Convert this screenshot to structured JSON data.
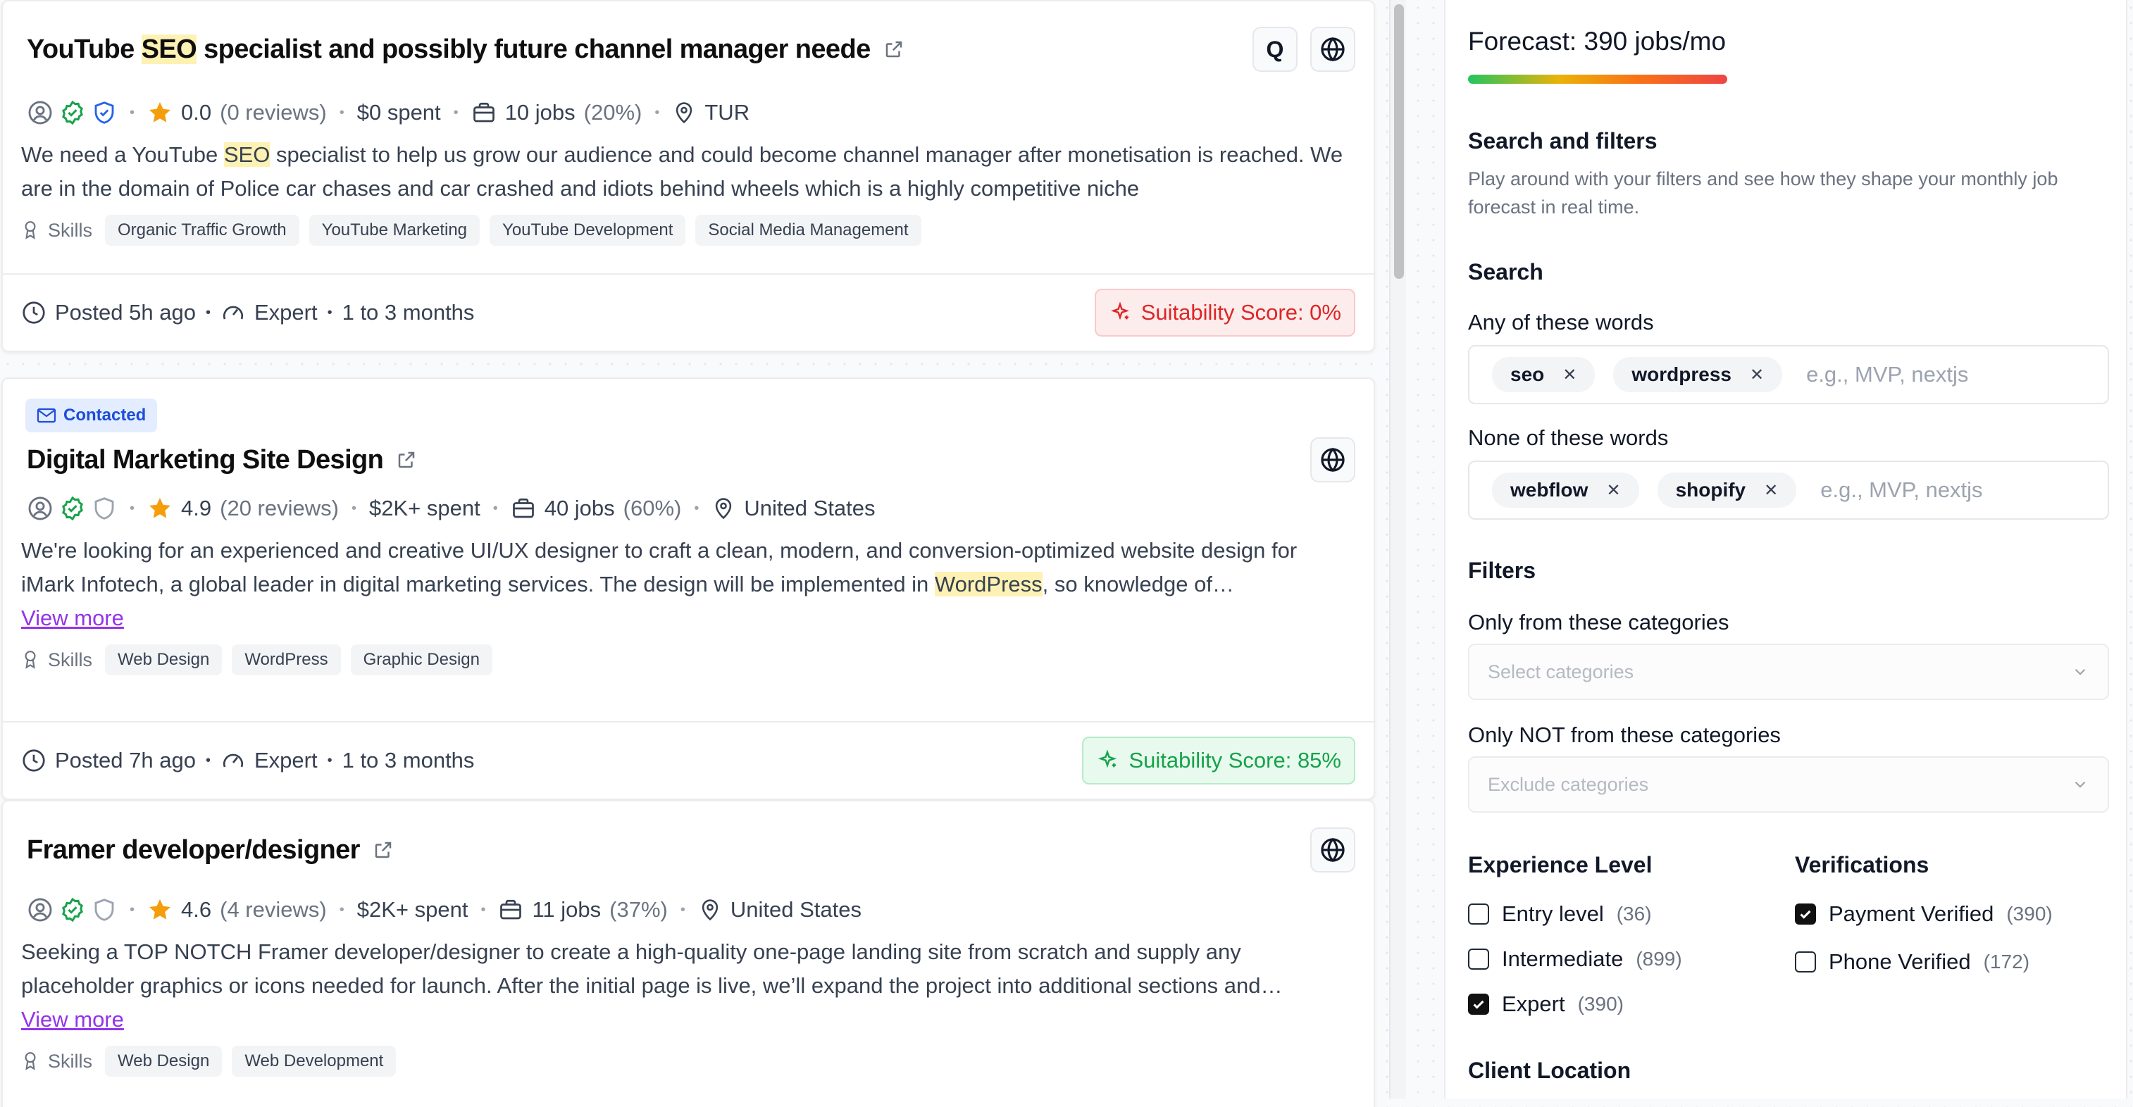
{
  "jobs": [
    {
      "contacted": false,
      "title_parts": [
        "YouTube ",
        "SEO",
        " specialist and possibly future channel manager neede"
      ],
      "show_q_button": true,
      "q_label": "Q",
      "rating": "0.0",
      "reviews": "(0 reviews)",
      "spent": "$0 spent",
      "jobs_count": "10 jobs",
      "jobs_pct": "(20%)",
      "location": "TUR",
      "payment_verified": true,
      "phone_verified": true,
      "desc_parts": [
        "We need a YouTube ",
        "SEO",
        " specialist to help us grow our audience and could become channel manager after monetisation is reached. We are in the domain of Police car chases and car crashed and idiots behind wheels which is a highly competitive niche"
      ],
      "view_more": "",
      "skills": [
        "Organic Traffic Growth",
        "YouTube Marketing",
        "YouTube Development",
        "Social Media Management"
      ],
      "posted": "Posted 5h ago",
      "level": "Expert",
      "duration": "1 to 3 months",
      "score": "Suitability Score: 0%",
      "score_kind": "bad"
    },
    {
      "contacted": true,
      "title_parts": [
        "Digital Marketing Site Design",
        "",
        ""
      ],
      "show_q_button": false,
      "q_label": "",
      "rating": "4.9",
      "reviews": "(20 reviews)",
      "spent": "$2K+ spent",
      "jobs_count": "40 jobs",
      "jobs_pct": "(60%)",
      "location": "United States",
      "payment_verified": true,
      "phone_verified": false,
      "desc_parts": [
        "We're looking for an experienced and creative UI/UX designer to craft a clean, modern, and conversion-optimized website design for iMark Infotech, a global leader in digital marketing services. The design will be implemented in ",
        "WordPress",
        ", so knowledge of…"
      ],
      "view_more": "View more",
      "skills": [
        "Web Design",
        "WordPress",
        "Graphic Design"
      ],
      "posted": "Posted 7h ago",
      "level": "Expert",
      "duration": "1 to 3 months",
      "score": "Suitability Score: 85%",
      "score_kind": "good"
    },
    {
      "contacted": false,
      "title_parts": [
        "Framer developer/designer",
        "",
        ""
      ],
      "show_q_button": false,
      "q_label": "",
      "rating": "4.6",
      "reviews": "(4 reviews)",
      "spent": "$2K+ spent",
      "jobs_count": "11 jobs",
      "jobs_pct": "(37%)",
      "location": "United States",
      "payment_verified": true,
      "phone_verified": false,
      "desc_parts": [
        "Seeking a TOP NOTCH Framer developer/designer to create a high-quality one-page landing site from scratch and supply any placeholder graphics or icons needed for launch. After the initial page is live, we’ll expand the project into additional sections and…",
        "",
        ""
      ],
      "view_more": "View more",
      "skills": [
        "Web Design",
        "Web Development"
      ],
      "posted": "",
      "level": "",
      "duration": "",
      "score": "",
      "score_kind": ""
    }
  ],
  "common": {
    "contacted_label": "Contacted",
    "skills_label": "Skills"
  },
  "panel": {
    "forecast": "Forecast: 390 jobs/mo",
    "search_filters_title": "Search and filters",
    "search_filters_desc": "Play around with your filters and see how they shape your monthly job forecast in real time.",
    "search_title": "Search",
    "any_words_label": "Any of these words",
    "any_words": [
      "seo",
      "wordpress"
    ],
    "none_words_label": "None of these words",
    "none_words": [
      "webflow",
      "shopify"
    ],
    "tag_placeholder": "e.g., MVP, nextjs",
    "filters_title": "Filters",
    "only_categories_label": "Only from these categories",
    "only_categories_placeholder": "Select categories",
    "not_categories_label": "Only NOT from these categories",
    "not_categories_placeholder": "Exclude categories",
    "experience_title": "Experience Level",
    "experience": [
      {
        "label": "Entry level",
        "count": "(36)",
        "checked": false
      },
      {
        "label": "Intermediate",
        "count": "(899)",
        "checked": false
      },
      {
        "label": "Expert",
        "count": "(390)",
        "checked": true
      }
    ],
    "verifications_title": "Verifications",
    "verifications": [
      {
        "label": "Payment Verified",
        "count": "(390)",
        "checked": true
      },
      {
        "label": "Phone Verified",
        "count": "(172)",
        "checked": false
      }
    ],
    "client_location_title": "Client Location"
  },
  "colors": {
    "star": "#f59e0b",
    "verified_green": "#16a34a",
    "verified_blue": "#2563eb",
    "unverified_gray": "#9ca3af",
    "highlight": "#fdf2b3",
    "view_more": "#9333ea"
  }
}
